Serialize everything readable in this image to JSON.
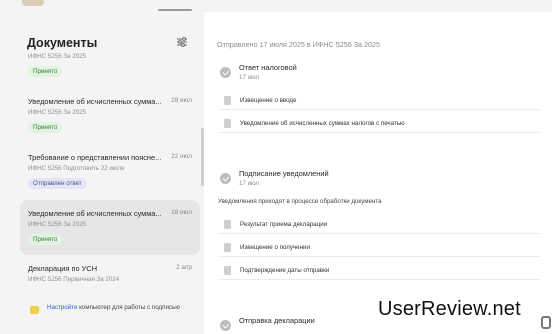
{
  "left": {
    "title": "Документы",
    "items": [
      {
        "title": "",
        "sub": "ИФНС 5256  За 2025",
        "badge": "Принято",
        "badge_kind": "ok",
        "date": ""
      },
      {
        "title": "Уведомление об исчисленных сумма...",
        "sub": "ИФНС 5256  За 2025",
        "badge": "Принято",
        "badge_kind": "ok",
        "date": "28 июл"
      },
      {
        "title": "Требование о представлении поясне...",
        "sub": "ИФНС 5256  Подготовить 22 июля",
        "badge": "Отправлен ответ",
        "badge_kind": "sent",
        "date": "22 июл"
      },
      {
        "title": "Уведомление об исчисленных сумма...",
        "sub": "ИФНС 5256  За 2025",
        "badge": "Принято",
        "badge_kind": "ok",
        "date": "18 июл"
      },
      {
        "title": "Декларация по УСН",
        "sub": "ИФНС 5256  Первичная  За 2024",
        "badge": "",
        "badge_kind": "",
        "date": "2 апр"
      }
    ],
    "hint": {
      "link": "Настройте",
      "text": " компьютер для работы с подписью"
    }
  },
  "right": {
    "sent_line": "Отправлено 17 июля 2025 в ИФНС 5256  За 2025",
    "steps": [
      {
        "title": "Ответ налоговой",
        "date": "17 июл",
        "note": "",
        "files": [
          "Извещение о вводе",
          "Уведомление об исчисленных суммах налогов с печатью"
        ]
      },
      {
        "title": "Подписание уведомлений",
        "date": "17 июл",
        "note": "Уведомления приходят в процессе обработки документа",
        "files": [
          "Результат приема декларации",
          "Извещение о получении",
          "Подтверждение даты отправки"
        ]
      },
      {
        "title": "Отправка декларации",
        "date": "",
        "note": "",
        "files": []
      }
    ]
  },
  "watermark": "UserReview.net",
  "icons": {
    "filter": "filter-sliders-icon",
    "check": "check-circle-icon",
    "file": "document-icon",
    "hint": "computer-hint-icon"
  },
  "colors": {
    "accepted_bg": "#e2f3e2",
    "accepted_text": "#3a7a3a",
    "sent_bg": "#e4e6f6",
    "sent_text": "#4a4f86",
    "link": "#2a5bd7"
  }
}
